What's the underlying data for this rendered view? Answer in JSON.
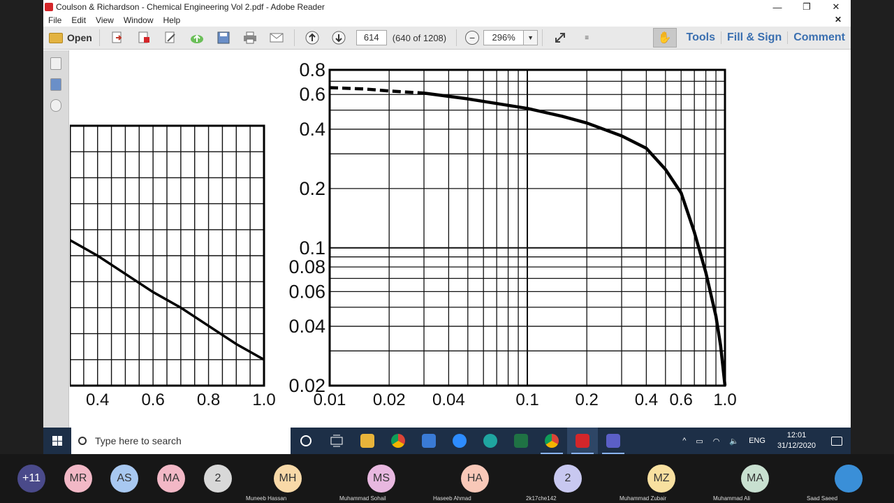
{
  "window": {
    "title": "Coulson & Richardson - Chemical Engineering Vol 2.pdf - Adobe Reader",
    "controls": [
      "—",
      "❐",
      "✕"
    ],
    "doc_close": "✕"
  },
  "menu": [
    "File",
    "Edit",
    "View",
    "Window",
    "Help"
  ],
  "toolbar": {
    "open_label": "Open",
    "page_number": "614",
    "page_count": "(640 of 1208)",
    "zoom": "296%",
    "zoom_out": "−",
    "tools": "Tools",
    "fill_sign": "Fill & Sign",
    "comment": "Comment"
  },
  "chart_data": [
    {
      "type": "line",
      "x_ticks": [
        "0.4",
        "0.6",
        "0.8",
        "1.0"
      ],
      "xlim": [
        0.3,
        1.0
      ],
      "series": [
        {
          "x": [
            0.3,
            0.4,
            0.5,
            0.6,
            0.7,
            0.8,
            0.9,
            1.0
          ],
          "y": [
            0.56,
            0.5,
            0.43,
            0.36,
            0.3,
            0.23,
            0.16,
            0.1
          ]
        }
      ]
    },
    {
      "type": "line",
      "x_scale": "log",
      "y_scale": "log",
      "xlim": [
        0.01,
        1.0
      ],
      "ylim": [
        0.02,
        0.8
      ],
      "x_ticks": [
        "0.01",
        "0.02",
        "0.04",
        "0.1",
        "0.2",
        "0.4",
        "0.6",
        "1.0"
      ],
      "x_tick_values": [
        0.01,
        0.02,
        0.04,
        0.1,
        0.2,
        0.4,
        0.6,
        1.0
      ],
      "y_ticks": [
        "0.8",
        "0.6",
        "0.4",
        "0.2",
        "0.1",
        "0.08",
        "0.06",
        "0.04",
        "0.02"
      ],
      "y_tick_values": [
        0.8,
        0.6,
        0.4,
        0.2,
        0.1,
        0.08,
        0.06,
        0.04,
        0.02
      ],
      "series": [
        {
          "style": "dashed",
          "x": [
            0.01,
            0.015,
            0.02,
            0.03
          ],
          "y": [
            0.65,
            0.64,
            0.625,
            0.61
          ]
        },
        {
          "style": "solid",
          "x": [
            0.03,
            0.05,
            0.1,
            0.15,
            0.2,
            0.3,
            0.4,
            0.5,
            0.6,
            0.7,
            0.8,
            0.9,
            0.95,
            1.0
          ],
          "y": [
            0.61,
            0.57,
            0.51,
            0.465,
            0.43,
            0.37,
            0.32,
            0.25,
            0.19,
            0.12,
            0.075,
            0.045,
            0.032,
            0.02
          ]
        }
      ]
    }
  ],
  "taskbar": {
    "search_placeholder": "Type here to search",
    "lang": "ENG",
    "time": "12:01",
    "date": "31/12/2020"
  },
  "participants": [
    {
      "initials": "+11",
      "name": "",
      "color": "#4a4a8a"
    },
    {
      "initials": "MR",
      "name": "",
      "color": "#f2b8c6"
    },
    {
      "initials": "AS",
      "name": "",
      "color": "#a8c8f0"
    },
    {
      "initials": "MA",
      "name": "",
      "color": "#f2b8c6"
    },
    {
      "initials": "2",
      "name": "",
      "color": "#d8d8d8"
    },
    {
      "initials": "MH",
      "name": "Muneeb  Hassan",
      "color": "#f8d9a8"
    },
    {
      "initials": "MS",
      "name": "Muhammad Sohail",
      "color": "#e8b8e0"
    },
    {
      "initials": "HA",
      "name": "Haseeb Ahmad",
      "color": "#f8c8b8"
    },
    {
      "initials": "2",
      "name": "2k17che142",
      "color": "#c8c8f0"
    },
    {
      "initials": "MZ",
      "name": "Muhammad Zubair",
      "color": "#f8e0a0"
    },
    {
      "initials": "MA",
      "name": "Muhammad Ali",
      "color": "#c8e0d0"
    },
    {
      "initials": "",
      "name": "Saad Saeed",
      "color": "#3a8fd8"
    }
  ]
}
